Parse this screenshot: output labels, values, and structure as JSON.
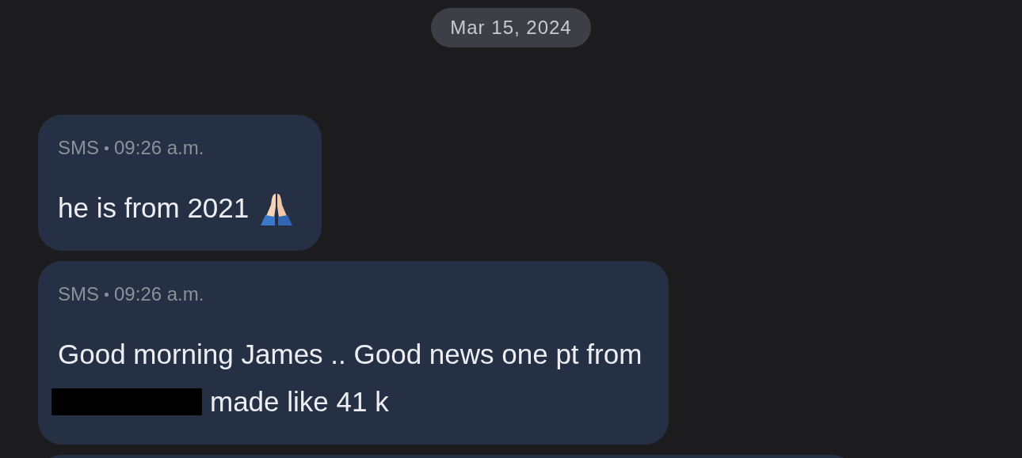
{
  "date_chip": "Mar 15, 2024",
  "messages": [
    {
      "kind": "bubble",
      "channel": "SMS",
      "time": "09:26 a.m.",
      "lines": [
        [
          {
            "kind": "text",
            "text": "he is from 2021"
          },
          {
            "kind": "praying-hands"
          }
        ]
      ]
    },
    {
      "kind": "bubble",
      "channel": "SMS",
      "time": "09:26 a.m.",
      "lines": [
        [
          {
            "kind": "text",
            "text": "Good morning James .. Good news one pt from"
          }
        ],
        [
          {
            "kind": "redaction"
          },
          {
            "kind": "text",
            "text": "made like 41 k"
          }
        ]
      ]
    },
    {
      "kind": "partial"
    }
  ]
}
